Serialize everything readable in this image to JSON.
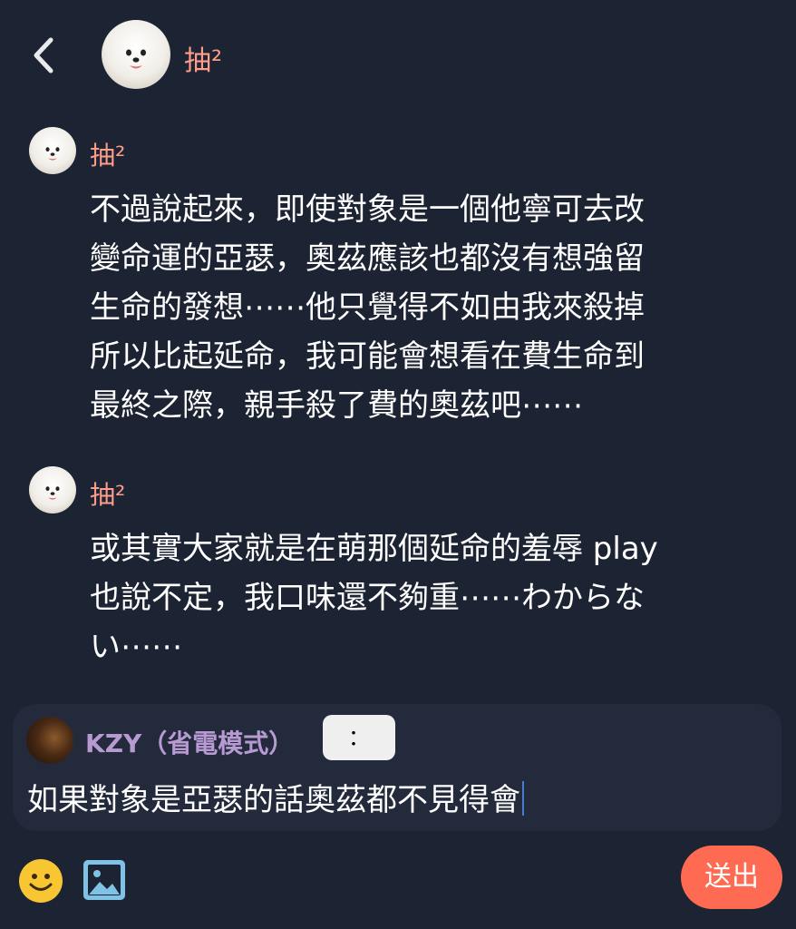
{
  "header": {
    "title": "抽²"
  },
  "messages": [
    {
      "sender": "抽²",
      "lines": [
        "不過說起來，即使對象是一個他寧可去改",
        "變命運的亞瑟，奧茲應該也都沒有想強留",
        "生命的發想⋯⋯他只覺得不如由我來殺掉",
        "所以比起延命，我可能會想看在費生命到",
        "最終之際，親手殺了費的奧茲吧⋯⋯"
      ]
    },
    {
      "sender": "抽²",
      "lines": [
        "或其實大家就是在萌那個延命的羞辱 play",
        "也說不定，我口味還不夠重⋯⋯わからな",
        "い⋯⋯"
      ]
    }
  ],
  "composer": {
    "user_name": "KZY（省電模式）",
    "colon_label": "：",
    "text": "如果對象是亞瑟的話奧茲都不見得會",
    "send_label": "送出"
  },
  "colors": {
    "background": "#1c2332",
    "sender_name": "#ff9d8a",
    "user_name": "#b89ad2",
    "send_button": "#ff6b52"
  },
  "icons": [
    "back-arrow-icon",
    "emoji-icon",
    "image-icon"
  ]
}
